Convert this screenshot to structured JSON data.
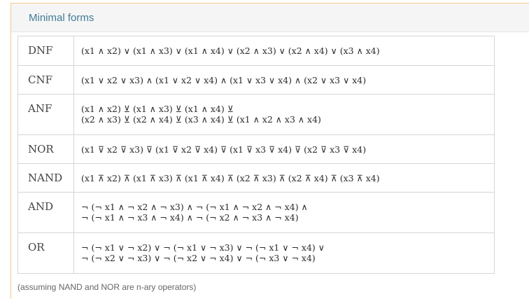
{
  "panel": {
    "title": "Minimal forms",
    "footnote": "(assuming NAND and NOR are n-ary operators)"
  },
  "rows": [
    {
      "label": "DNF",
      "lines": [
        "(x1 ∧ x2) ∨ (x1 ∧ x3) ∨ (x1 ∧ x4) ∨ (x2 ∧ x3) ∨ (x2 ∧ x4) ∨ (x3 ∧ x4)"
      ]
    },
    {
      "label": "CNF",
      "lines": [
        "(x1 ∨ x2 ∨ x3) ∧ (x1 ∨ x2 ∨ x4) ∧ (x1 ∨ x3 ∨ x4) ∧ (x2 ∨ x3 ∨ x4)"
      ]
    },
    {
      "label": "ANF",
      "lines": [
        "(x1 ∧ x2) ⊻ (x1 ∧ x3) ⊻ (x1 ∧ x4) ⊻",
        "(x2 ∧ x3) ⊻ (x2 ∧ x4) ⊻ (x3 ∧ x4) ⊻ (x1 ∧ x2 ∧ x3 ∧ x4)"
      ]
    },
    {
      "label": "NOR",
      "lines": [
        "(x1 ⊽ x2 ⊽ x3) ⊽ (x1 ⊽ x2 ⊽ x4) ⊽ (x1 ⊽ x3 ⊽ x4) ⊽ (x2 ⊽ x3 ⊽ x4)"
      ]
    },
    {
      "label": "NAND",
      "lines": [
        "(x1 ⊼ x2) ⊼ (x1 ⊼ x3) ⊼ (x1 ⊼ x4) ⊼ (x2 ⊼ x3) ⊼ (x2 ⊼ x4) ⊼ (x3 ⊼ x4)"
      ]
    },
    {
      "label": "AND",
      "lines": [
        "¬ (¬ x1 ∧ ¬ x2 ∧ ¬ x3) ∧ ¬ (¬ x1 ∧ ¬ x2 ∧ ¬ x4) ∧",
        "¬ (¬ x1 ∧ ¬ x3 ∧ ¬ x4) ∧ ¬ (¬ x2 ∧ ¬ x3 ∧ ¬ x4)"
      ]
    },
    {
      "label": "OR",
      "lines": [
        "¬ (¬ x1 ∨ ¬ x2) ∨ ¬ (¬ x1 ∨ ¬ x3) ∨ ¬ (¬ x1 ∨ ¬ x4) ∨",
        "¬ (¬ x2 ∨ ¬ x3) ∨ ¬ (¬ x2 ∨ ¬ x4) ∨ ¬ (¬ x3 ∨ ¬ x4)"
      ]
    }
  ]
}
